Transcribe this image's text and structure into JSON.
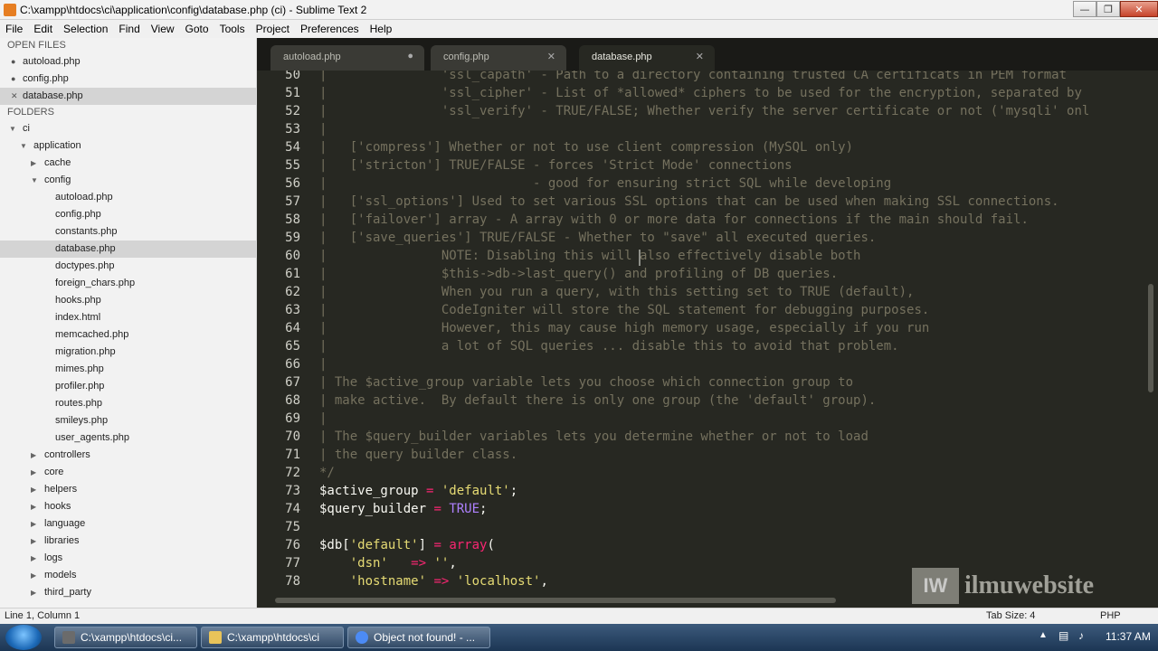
{
  "window": {
    "title": "C:\\xampp\\htdocs\\ci\\application\\config\\database.php (ci) - Sublime Text 2",
    "minimize_glyph": "—",
    "maximize_glyph": "❐",
    "close_glyph": "✕"
  },
  "menu": [
    "File",
    "Edit",
    "Selection",
    "Find",
    "View",
    "Goto",
    "Tools",
    "Project",
    "Preferences",
    "Help"
  ],
  "sidebar": {
    "open_files_header": "OPEN FILES",
    "open_files": [
      {
        "label": "autoload.php",
        "marker": "●"
      },
      {
        "label": "config.php",
        "marker": "●"
      },
      {
        "label": "database.php",
        "marker": "✕"
      }
    ],
    "folders_header": "FOLDERS",
    "tree": [
      {
        "label": "ci",
        "depth": 0,
        "arrow": "▼"
      },
      {
        "label": "application",
        "depth": 1,
        "arrow": "▼"
      },
      {
        "label": "cache",
        "depth": 2,
        "arrow": "▶"
      },
      {
        "label": "config",
        "depth": 2,
        "arrow": "▼"
      },
      {
        "label": "autoload.php",
        "depth": 3,
        "arrow": ""
      },
      {
        "label": "config.php",
        "depth": 3,
        "arrow": ""
      },
      {
        "label": "constants.php",
        "depth": 3,
        "arrow": ""
      },
      {
        "label": "database.php",
        "depth": 3,
        "arrow": ""
      },
      {
        "label": "doctypes.php",
        "depth": 3,
        "arrow": ""
      },
      {
        "label": "foreign_chars.php",
        "depth": 3,
        "arrow": ""
      },
      {
        "label": "hooks.php",
        "depth": 3,
        "arrow": ""
      },
      {
        "label": "index.html",
        "depth": 3,
        "arrow": ""
      },
      {
        "label": "memcached.php",
        "depth": 3,
        "arrow": ""
      },
      {
        "label": "migration.php",
        "depth": 3,
        "arrow": ""
      },
      {
        "label": "mimes.php",
        "depth": 3,
        "arrow": ""
      },
      {
        "label": "profiler.php",
        "depth": 3,
        "arrow": ""
      },
      {
        "label": "routes.php",
        "depth": 3,
        "arrow": ""
      },
      {
        "label": "smileys.php",
        "depth": 3,
        "arrow": ""
      },
      {
        "label": "user_agents.php",
        "depth": 3,
        "arrow": ""
      },
      {
        "label": "controllers",
        "depth": 2,
        "arrow": "▶"
      },
      {
        "label": "core",
        "depth": 2,
        "arrow": "▶"
      },
      {
        "label": "helpers",
        "depth": 2,
        "arrow": "▶"
      },
      {
        "label": "hooks",
        "depth": 2,
        "arrow": "▶"
      },
      {
        "label": "language",
        "depth": 2,
        "arrow": "▶"
      },
      {
        "label": "libraries",
        "depth": 2,
        "arrow": "▶"
      },
      {
        "label": "logs",
        "depth": 2,
        "arrow": "▶"
      },
      {
        "label": "models",
        "depth": 2,
        "arrow": "▶"
      },
      {
        "label": "third_party",
        "depth": 2,
        "arrow": "▶"
      }
    ]
  },
  "tabs": [
    {
      "label": "autoload.php",
      "close": "●",
      "active": false
    },
    {
      "label": "config.php",
      "close": "✕",
      "active": false
    },
    {
      "label": "database.php",
      "close": "✕",
      "active": true
    }
  ],
  "code_lines": [
    {
      "n": "50",
      "tokens": [
        [
          "cm",
          "|               'ssl_capath' - Path to a directory containing trusted CA certificats in PEM format"
        ]
      ]
    },
    {
      "n": "51",
      "tokens": [
        [
          "cm",
          "|               'ssl_cipher' - List of *allowed* ciphers to be used for the encryption, separated by"
        ]
      ]
    },
    {
      "n": "52",
      "tokens": [
        [
          "cm",
          "|               'ssl_verify' - TRUE/FALSE; Whether verify the server certificate or not ('mysqli' onl"
        ]
      ]
    },
    {
      "n": "53",
      "tokens": [
        [
          "cm",
          "|"
        ]
      ]
    },
    {
      "n": "54",
      "tokens": [
        [
          "cm",
          "|   ['compress'] Whether or not to use client compression (MySQL only)"
        ]
      ]
    },
    {
      "n": "55",
      "tokens": [
        [
          "cm",
          "|   ['stricton'] TRUE/FALSE - forces 'Strict Mode' connections"
        ]
      ]
    },
    {
      "n": "56",
      "tokens": [
        [
          "cm",
          "|                           - good for ensuring strict SQL while developing"
        ]
      ]
    },
    {
      "n": "57",
      "tokens": [
        [
          "cm",
          "|   ['ssl_options'] Used to set various SSL options that can be used when making SSL connections."
        ]
      ]
    },
    {
      "n": "58",
      "tokens": [
        [
          "cm",
          "|   ['failover'] array - A array with 0 or more data for connections if the main should fail."
        ]
      ]
    },
    {
      "n": "59",
      "tokens": [
        [
          "cm",
          "|   ['save_queries'] TRUE/FALSE - Whether to \"save\" all executed queries."
        ]
      ]
    },
    {
      "n": "60",
      "tokens": [
        [
          "cm",
          "|               NOTE: Disabling this will also effectively disable both"
        ]
      ]
    },
    {
      "n": "61",
      "tokens": [
        [
          "cm",
          "|               $this->db->last_query() and profiling of DB queries."
        ]
      ]
    },
    {
      "n": "62",
      "tokens": [
        [
          "cm",
          "|               When you run a query, with this setting set to TRUE (default),"
        ]
      ]
    },
    {
      "n": "63",
      "tokens": [
        [
          "cm",
          "|               CodeIgniter will store the SQL statement for debugging purposes."
        ]
      ]
    },
    {
      "n": "64",
      "tokens": [
        [
          "cm",
          "|               However, this may cause high memory usage, especially if you run"
        ]
      ]
    },
    {
      "n": "65",
      "tokens": [
        [
          "cm",
          "|               a lot of SQL queries ... disable this to avoid that problem."
        ]
      ]
    },
    {
      "n": "66",
      "tokens": [
        [
          "cm",
          "|"
        ]
      ]
    },
    {
      "n": "67",
      "tokens": [
        [
          "cm",
          "| The $active_group variable lets you choose which connection group to"
        ]
      ]
    },
    {
      "n": "68",
      "tokens": [
        [
          "cm",
          "| make active.  By default there is only one group (the 'default' group)."
        ]
      ]
    },
    {
      "n": "69",
      "tokens": [
        [
          "cm",
          "|"
        ]
      ]
    },
    {
      "n": "70",
      "tokens": [
        [
          "cm",
          "| The $query_builder variables lets you determine whether or not to load"
        ]
      ]
    },
    {
      "n": "71",
      "tokens": [
        [
          "cm",
          "| the query builder class."
        ]
      ]
    },
    {
      "n": "72",
      "tokens": [
        [
          "cm",
          "*/"
        ]
      ]
    },
    {
      "n": "73",
      "tokens": [
        [
          "var",
          "$active_group"
        ],
        [
          "kw",
          " = "
        ],
        [
          "str",
          "'default'"
        ],
        [
          "punc",
          ";"
        ]
      ]
    },
    {
      "n": "74",
      "tokens": [
        [
          "var",
          "$query_builder"
        ],
        [
          "kw",
          " = "
        ],
        [
          "const",
          "TRUE"
        ],
        [
          "punc",
          ";"
        ]
      ]
    },
    {
      "n": "75",
      "tokens": []
    },
    {
      "n": "76",
      "tokens": [
        [
          "var",
          "$db"
        ],
        [
          "punc",
          "["
        ],
        [
          "str",
          "'default'"
        ],
        [
          "punc",
          "]"
        ],
        [
          "kw",
          " = "
        ],
        [
          "kw",
          "array"
        ],
        [
          "punc",
          "("
        ]
      ]
    },
    {
      "n": "77",
      "tokens": [
        [
          "punc",
          "    "
        ],
        [
          "str",
          "'dsn'"
        ],
        [
          "punc",
          "   "
        ],
        [
          "kw",
          "=>"
        ],
        [
          "punc",
          " "
        ],
        [
          "str",
          "''"
        ],
        [
          "punc",
          ","
        ]
      ]
    },
    {
      "n": "78",
      "tokens": [
        [
          "punc",
          "    "
        ],
        [
          "str",
          "'hostname'"
        ],
        [
          "punc",
          " "
        ],
        [
          "kw",
          "=>"
        ],
        [
          "punc",
          " "
        ],
        [
          "str",
          "'localhost'"
        ],
        [
          "punc",
          ","
        ]
      ]
    }
  ],
  "watermark": {
    "logo": "IW",
    "text": "ilmuwebsite"
  },
  "status": {
    "position": "Line 1, Column 1",
    "tab_size": "Tab Size: 4",
    "syntax": "PHP"
  },
  "taskbar": {
    "tasks": [
      {
        "label": "C:\\xampp\\htdocs\\ci...",
        "icon_color": "#6b6b6b"
      },
      {
        "label": "C:\\xampp\\htdocs\\ci",
        "icon_color": "#e8c35a"
      },
      {
        "label": "Object not found! - ...",
        "icon_color": "#4c8bf5"
      }
    ],
    "tray_arrow": "▲",
    "clock": "11:37 AM"
  },
  "colors": {
    "editor_bg": "#272822",
    "comment": "#75715e",
    "string": "#e6db74",
    "keyword": "#f92672",
    "constant": "#ae81ff"
  }
}
